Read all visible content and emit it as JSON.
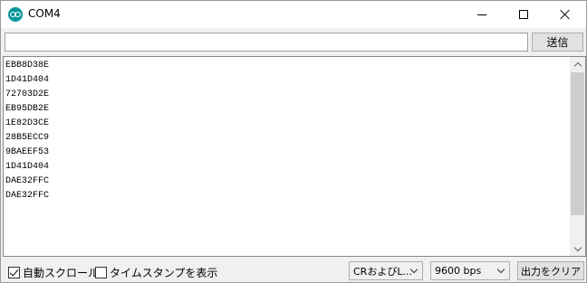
{
  "window": {
    "title": "COM4"
  },
  "send": {
    "input_value": "",
    "button_label": "送信"
  },
  "output": {
    "lines": [
      "EBB8D38E",
      "1D41D404",
      "72703D2E",
      "EB95DB2E",
      "1E82D3CE",
      "28B5ECC9",
      "9BAEEF53",
      "1D41D404",
      "DAE32FFC",
      "DAE32FFC"
    ]
  },
  "footer": {
    "autoscroll_label": "自動スクロール",
    "autoscroll_checked": true,
    "timestamp_label": "タイムスタンプを表示",
    "timestamp_checked": false,
    "line_ending_value": "CRおよびL...",
    "baud_value": "9600 bps",
    "clear_label": "出力をクリア"
  },
  "icons": {
    "app": "arduino-icon",
    "minimize": "minimize-icon",
    "maximize": "maximize-icon",
    "close": "close-icon"
  },
  "colors": {
    "accent": "#00979c"
  }
}
